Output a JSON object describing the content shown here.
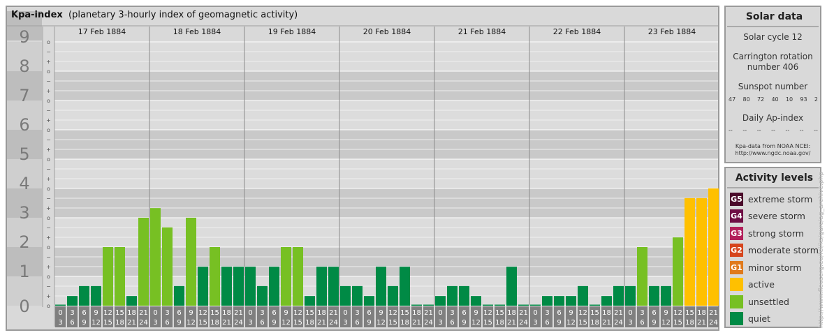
{
  "header": {
    "title": "Kpa-index",
    "subtitle": "(planetary 3-hourly index of geomagnetic activity)"
  },
  "chart_data": {
    "type": "bar",
    "title": "Kpa-index",
    "subtitle": "(planetary 3-hourly index of geomagnetic activity)",
    "ylim": [
      0,
      9
    ],
    "y_ticks": [
      "0",
      "1",
      "2",
      "3",
      "4",
      "5",
      "6",
      "7",
      "8",
      "9"
    ],
    "y_minor_ticks": [
      "o",
      "+",
      "−"
    ],
    "days": [
      "17 Feb 1884",
      "18 Feb 1884",
      "19 Feb 1884",
      "20 Feb 1884",
      "21 Feb 1884",
      "22 Feb 1884",
      "23 Feb 1884"
    ],
    "interval_labels": [
      [
        "0",
        "3"
      ],
      [
        "3",
        "6"
      ],
      [
        "6",
        "9"
      ],
      [
        "9",
        "12"
      ],
      [
        "12",
        "15"
      ],
      [
        "15",
        "18"
      ],
      [
        "18",
        "21"
      ],
      [
        "21",
        "24"
      ]
    ],
    "values": [
      [
        0.0,
        0.33,
        0.67,
        0.67,
        2.0,
        2.0,
        0.33,
        3.0
      ],
      [
        3.33,
        2.67,
        0.67,
        3.0,
        1.33,
        2.0,
        1.33,
        1.33
      ],
      [
        1.33,
        0.67,
        1.33,
        2.0,
        2.0,
        0.33,
        1.33,
        1.33
      ],
      [
        0.67,
        0.67,
        0.33,
        1.33,
        0.67,
        1.33,
        0.0,
        0.0
      ],
      [
        0.33,
        0.67,
        0.67,
        0.33,
        0.0,
        0.0,
        1.33,
        0.0
      ],
      [
        0.0,
        0.33,
        0.33,
        0.33,
        0.67,
        0.0,
        0.33,
        0.67
      ],
      [
        0.67,
        2.0,
        0.67,
        0.67,
        2.33,
        3.67,
        3.67,
        4.0
      ]
    ],
    "colors": {
      "quiet": "#008a45",
      "unsettled": "#77c023",
      "active": "#ffc000",
      "minor": "#e07a1c",
      "moderate": "#d6451c",
      "strong": "#b21f5a",
      "severe": "#6e0d44",
      "extreme": "#4a0a2a"
    },
    "grid": true
  },
  "solar": {
    "title": "Solar data",
    "cycle": "Solar cycle 12",
    "carrington_line1": "Carrington rotation",
    "carrington_line2": "number 406",
    "sunspot_label": "Sunspot number",
    "sunspot_values": [
      "47",
      "80",
      "72",
      "40",
      "10",
      "93",
      "2"
    ],
    "ap_label": "Daily Ap-index",
    "ap_values": [
      "--",
      "--",
      "--",
      "--",
      "--",
      "--",
      "--"
    ],
    "source_line1": "Kpa-data from NOAA NCEI:",
    "source_line2": "http://www.ngdc.noaa.gov/"
  },
  "activity": {
    "title": "Activity levels",
    "items": [
      {
        "code": "G5",
        "label": "extreme storm",
        "color": "#4a0a2a"
      },
      {
        "code": "G4",
        "label": "severe storm",
        "color": "#6e0d44"
      },
      {
        "code": "G3",
        "label": "strong storm",
        "color": "#b21f5a"
      },
      {
        "code": "G2",
        "label": "moderate storm",
        "color": "#d6451c"
      },
      {
        "code": "G1",
        "label": "minor storm",
        "color": "#e07a1c"
      },
      {
        "code": "",
        "label": "active",
        "color": "#ffc000"
      },
      {
        "code": "",
        "label": "unsettled",
        "color": "#77c023"
      },
      {
        "code": "",
        "label": "quiet",
        "color": "#008a45"
      }
    ]
  },
  "credit": "http://www.fleuserg.eu/fel/ks/gurc/ag_archive.php"
}
